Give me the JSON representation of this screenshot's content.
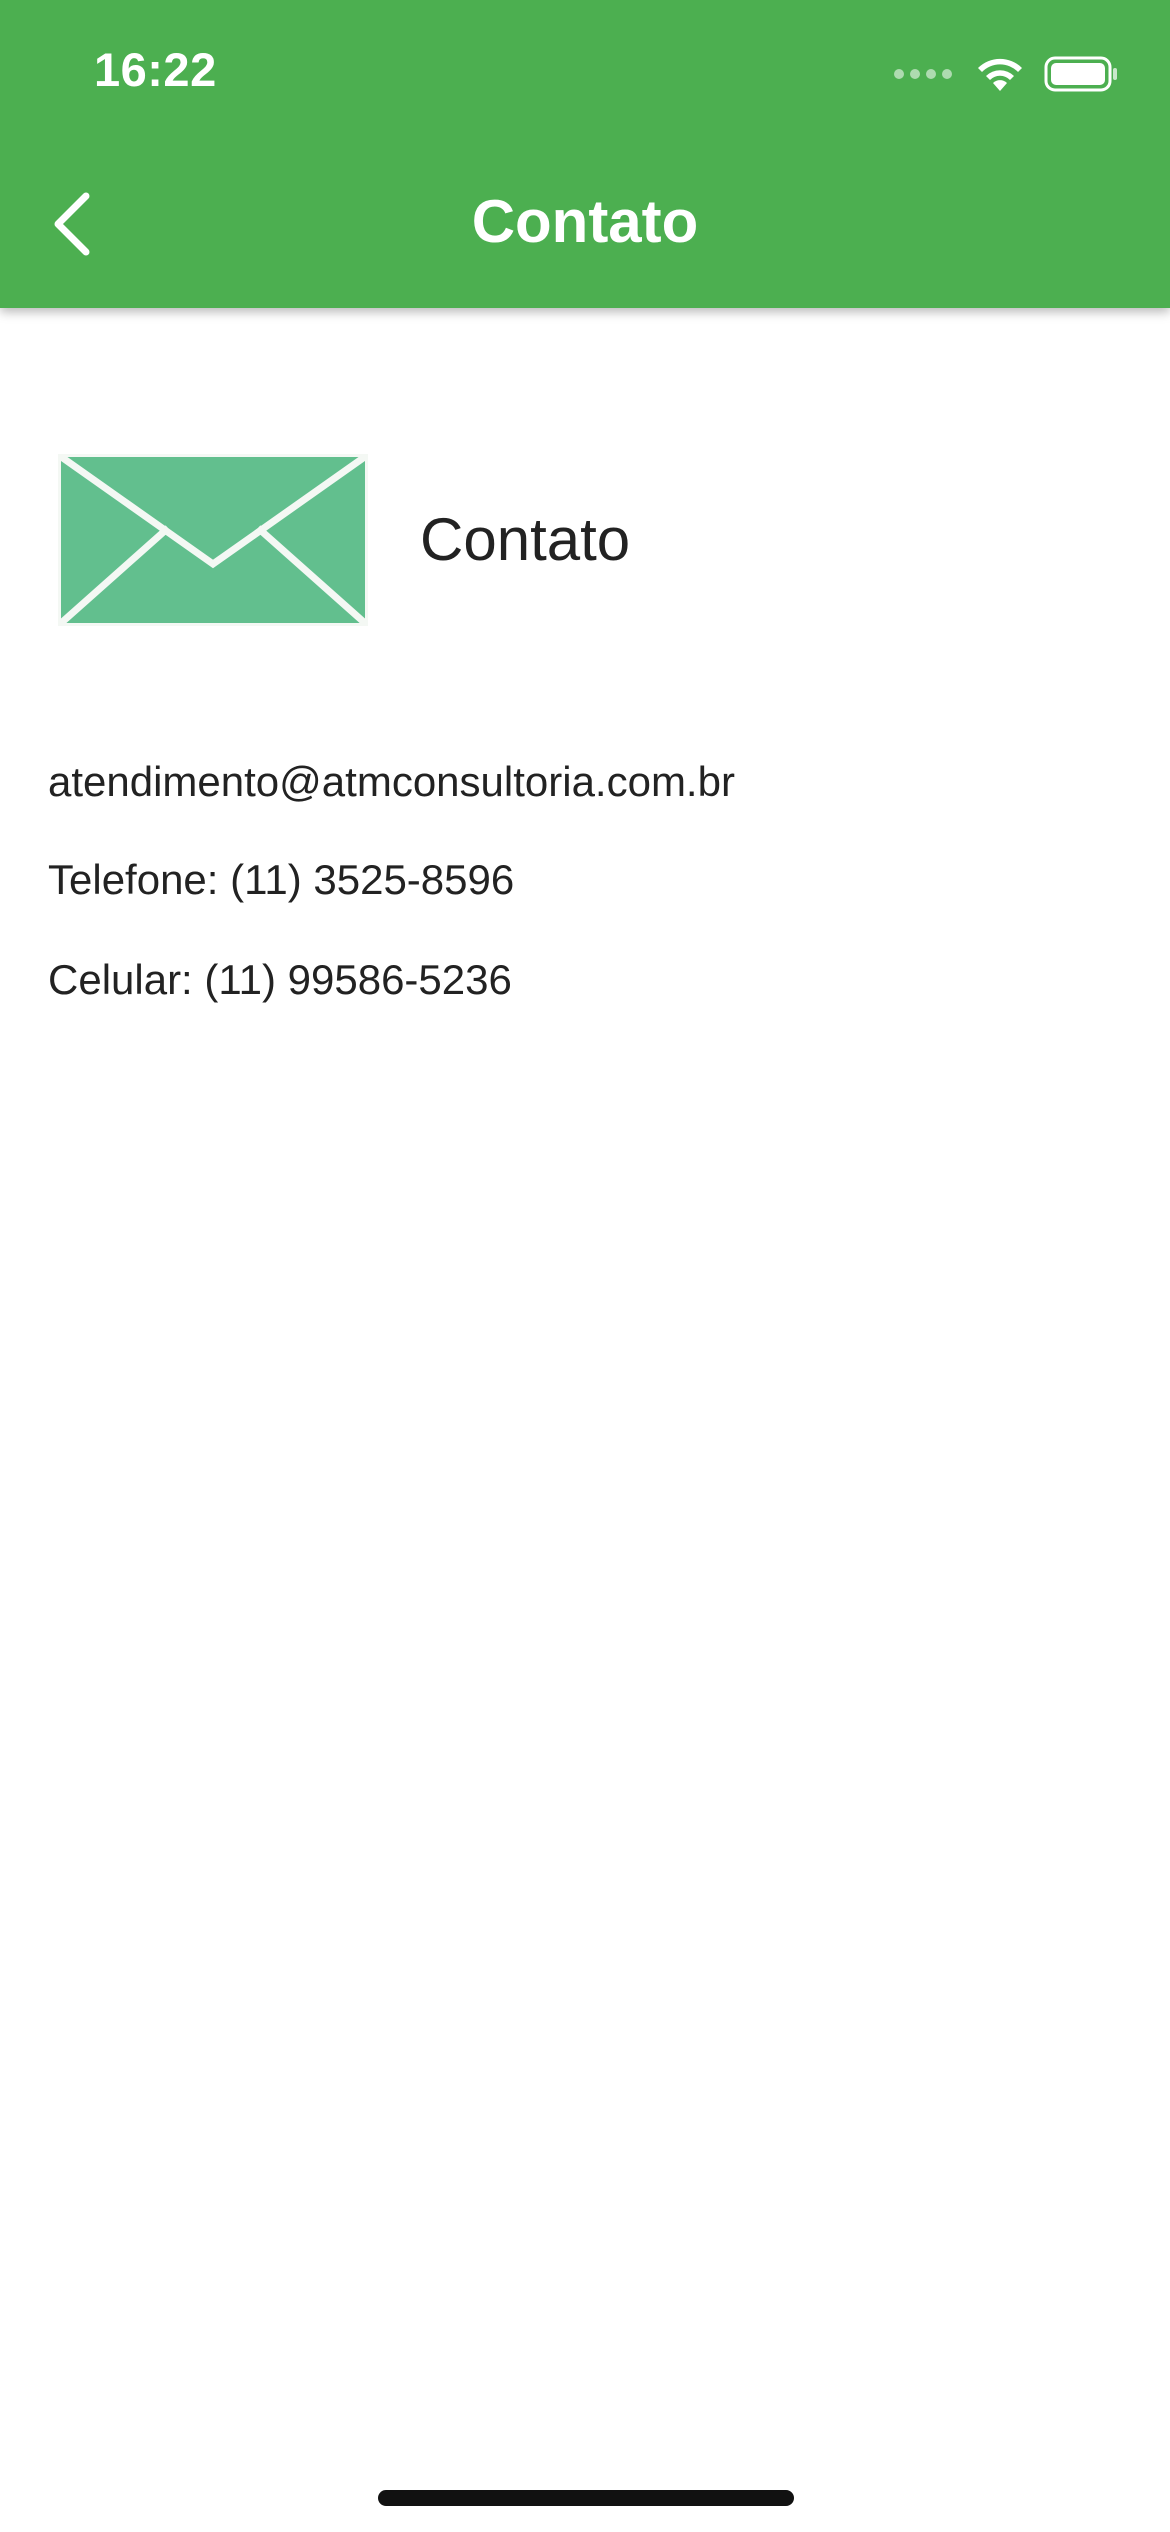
{
  "status_bar": {
    "time": "16:22",
    "wifi_icon": "wifi-icon",
    "battery_icon": "battery-icon"
  },
  "app_bar": {
    "title": "Contato",
    "back_icon": "chevron-left-icon",
    "background_color": "#4caf50"
  },
  "contact": {
    "icon": "envelope-icon",
    "icon_color": "#62bf8e",
    "title": "Contato",
    "email": "atendimento@atmconsultoria.com.br",
    "phone": "Telefone: (11) 3525-8596",
    "mobile": "Celular: (11) 99586-5236"
  }
}
